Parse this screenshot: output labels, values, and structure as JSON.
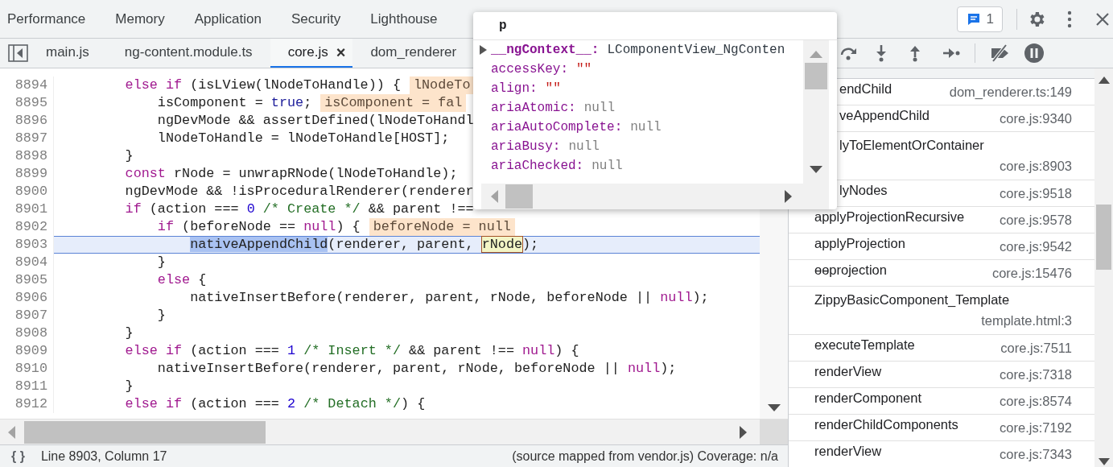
{
  "panel_tabs": [
    {
      "label": "Performance",
      "selected": false
    },
    {
      "label": "Memory",
      "selected": false
    },
    {
      "label": "Application",
      "selected": false
    },
    {
      "label": "Security",
      "selected": false
    },
    {
      "label": "Lighthouse",
      "selected": false
    }
  ],
  "issues_button": {
    "count": "1"
  },
  "file_tabs": [
    {
      "label": "main.js",
      "selected": false
    },
    {
      "label": "ng-content.module.ts",
      "selected": false
    },
    {
      "label": "core.js",
      "selected": true,
      "close": "×"
    },
    {
      "label": "dom_renderer",
      "selected": false
    }
  ],
  "code": {
    "lines": [
      {
        "number": "8894",
        "current": false,
        "tokens": [
          {
            "kind": "keyword",
            "text": "        else if"
          },
          {
            "kind": "plain",
            "text": " (isLView(lNodeToHandle)) {"
          }
        ],
        "inline_value": "lNodeTo"
      },
      {
        "number": "8895",
        "current": false,
        "tokens": [
          {
            "kind": "plain",
            "text": "            isComponent = "
          },
          {
            "kind": "literal",
            "text": "true"
          },
          {
            "kind": "plain",
            "text": ";"
          }
        ],
        "inline_value": "isComponent = fal"
      },
      {
        "number": "8896",
        "current": false,
        "tokens": [
          {
            "kind": "plain",
            "text": "            ngDevMode && assertDefined(lNodeToHandl"
          }
        ]
      },
      {
        "number": "8897",
        "current": false,
        "tokens": [
          {
            "kind": "plain",
            "text": "            lNodeToHandle = lNodeToHandle[HOST];"
          }
        ]
      },
      {
        "number": "8898",
        "current": false,
        "tokens": [
          {
            "kind": "plain",
            "text": "        }"
          }
        ]
      },
      {
        "number": "8899",
        "current": false,
        "tokens": [
          {
            "kind": "keyword",
            "text": "        const"
          },
          {
            "kind": "plain",
            "text": " rNode = unwrapRNode(lNodeToHandle);"
          }
        ]
      },
      {
        "number": "8900",
        "current": false,
        "tokens": [
          {
            "kind": "plain",
            "text": "        ngDevMode && !isProceduralRenderer(renderer"
          }
        ]
      },
      {
        "number": "8901",
        "current": false,
        "tokens": [
          {
            "kind": "keyword",
            "text": "        if"
          },
          {
            "kind": "plain",
            "text": " (action === "
          },
          {
            "kind": "number",
            "text": "0"
          },
          {
            "kind": "comment",
            "text": " /* Create */"
          },
          {
            "kind": "plain",
            "text": " && parent !=="
          }
        ]
      },
      {
        "number": "8902",
        "current": false,
        "tokens": [
          {
            "kind": "keyword",
            "text": "            if"
          },
          {
            "kind": "plain",
            "text": " (beforeNode == "
          },
          {
            "kind": "keyword",
            "text": "null"
          },
          {
            "kind": "plain",
            "text": ") {"
          }
        ],
        "inline_value": "beforeNode = null"
      },
      {
        "number": "8903",
        "current": true,
        "tokens": [
          {
            "kind": "selection",
            "text": "                nativeAppendChild"
          },
          {
            "kind": "plain",
            "text": "(renderer, parent, "
          },
          {
            "kind": "hovered",
            "text": "rNode"
          },
          {
            "kind": "plain",
            "text": ");"
          }
        ]
      },
      {
        "number": "8904",
        "current": false,
        "tokens": [
          {
            "kind": "plain",
            "text": "            }"
          }
        ]
      },
      {
        "number": "8905",
        "current": false,
        "tokens": [
          {
            "kind": "keyword",
            "text": "            else"
          },
          {
            "kind": "plain",
            "text": " {"
          }
        ]
      },
      {
        "number": "8906",
        "current": false,
        "tokens": [
          {
            "kind": "plain",
            "text": "                nativeInsertBefore(renderer, parent, rNode, beforeNode || "
          },
          {
            "kind": "keyword",
            "text": "null"
          },
          {
            "kind": "plain",
            "text": ");"
          }
        ]
      },
      {
        "number": "8907",
        "current": false,
        "tokens": [
          {
            "kind": "plain",
            "text": "            }"
          }
        ]
      },
      {
        "number": "8908",
        "current": false,
        "tokens": [
          {
            "kind": "plain",
            "text": "        }"
          }
        ]
      },
      {
        "number": "8909",
        "current": false,
        "tokens": [
          {
            "kind": "keyword",
            "text": "        else if"
          },
          {
            "kind": "plain",
            "text": " (action === "
          },
          {
            "kind": "number",
            "text": "1"
          },
          {
            "kind": "comment",
            "text": " /* Insert */"
          },
          {
            "kind": "plain",
            "text": " && parent !== "
          },
          {
            "kind": "keyword",
            "text": "null"
          },
          {
            "kind": "plain",
            "text": ") {"
          }
        ]
      },
      {
        "number": "8910",
        "current": false,
        "tokens": [
          {
            "kind": "plain",
            "text": "            nativeInsertBefore(renderer, parent, rNode, beforeNode || "
          },
          {
            "kind": "keyword",
            "text": "null"
          },
          {
            "kind": "plain",
            "text": ");"
          }
        ]
      },
      {
        "number": "8911",
        "current": false,
        "tokens": [
          {
            "kind": "plain",
            "text": "        }"
          }
        ]
      },
      {
        "number": "8912",
        "current": false,
        "tokens": [
          {
            "kind": "keyword",
            "text": "        else if"
          },
          {
            "kind": "plain",
            "text": " (action === "
          },
          {
            "kind": "number",
            "text": "2"
          },
          {
            "kind": "comment",
            "text": " /* Detach */"
          },
          {
            "kind": "plain",
            "text": ") {"
          }
        ]
      }
    ]
  },
  "popover": {
    "title": "p",
    "properties": [
      {
        "name": "__ngContext__:",
        "value": "LComponentView_NgConten",
        "color": "#303942",
        "expandable": true
      },
      {
        "name": "accessKey:",
        "value": "\"\"",
        "color": "#c41a16",
        "expandable": false
      },
      {
        "name": "align:",
        "value": "\"\"",
        "color": "#c41a16",
        "expandable": false
      },
      {
        "name": "ariaAtomic:",
        "value": "null",
        "color": "#808080",
        "expandable": false
      },
      {
        "name": "ariaAutoComplete:",
        "value": "null",
        "color": "#808080",
        "expandable": false
      },
      {
        "name": "ariaBusy:",
        "value": "null",
        "color": "#808080",
        "expandable": false
      },
      {
        "name": "ariaChecked:",
        "value": "null",
        "color": "#808080",
        "expandable": false
      }
    ]
  },
  "call_stack": {
    "frames": [
      {
        "name": "endChild",
        "location": "dom_renderer.ts:149",
        "wrapped": false
      },
      {
        "name": "veAppendChild",
        "location": "core.js:9340",
        "wrapped": false
      },
      {
        "name": "lyToElementOrContainer",
        "location": "core.js:8903",
        "wrapped": true
      },
      {
        "name": "lyNodes",
        "location": "core.js:9518",
        "wrapped": false
      },
      {
        "name": "applyProjectionRecursive",
        "location": "core.js:9578",
        "wrapped": false
      },
      {
        "name": "applyProjection",
        "location": "core.js:9542",
        "wrapped": false
      },
      {
        "name": "ɵɵprojection",
        "location": "core.js:15476",
        "wrapped": false
      },
      {
        "name": "ZippyBasicComponent_Template",
        "location": "template.html:3",
        "wrapped": true
      },
      {
        "name": "executeTemplate",
        "location": "core.js:7511",
        "wrapped": false
      },
      {
        "name": "renderView",
        "location": "core.js:7318",
        "wrapped": false
      },
      {
        "name": "renderComponent",
        "location": "core.js:8574",
        "wrapped": false
      },
      {
        "name": "renderChildComponents",
        "location": "core.js:7192",
        "wrapped": false
      },
      {
        "name": "renderView",
        "location": "core.js:7343",
        "wrapped": false
      }
    ]
  },
  "status_bar": {
    "format_button": "{ }",
    "position": "Line 8903, Column 17",
    "source_info": "(source mapped from vendor.js) Coverage: n/a"
  }
}
